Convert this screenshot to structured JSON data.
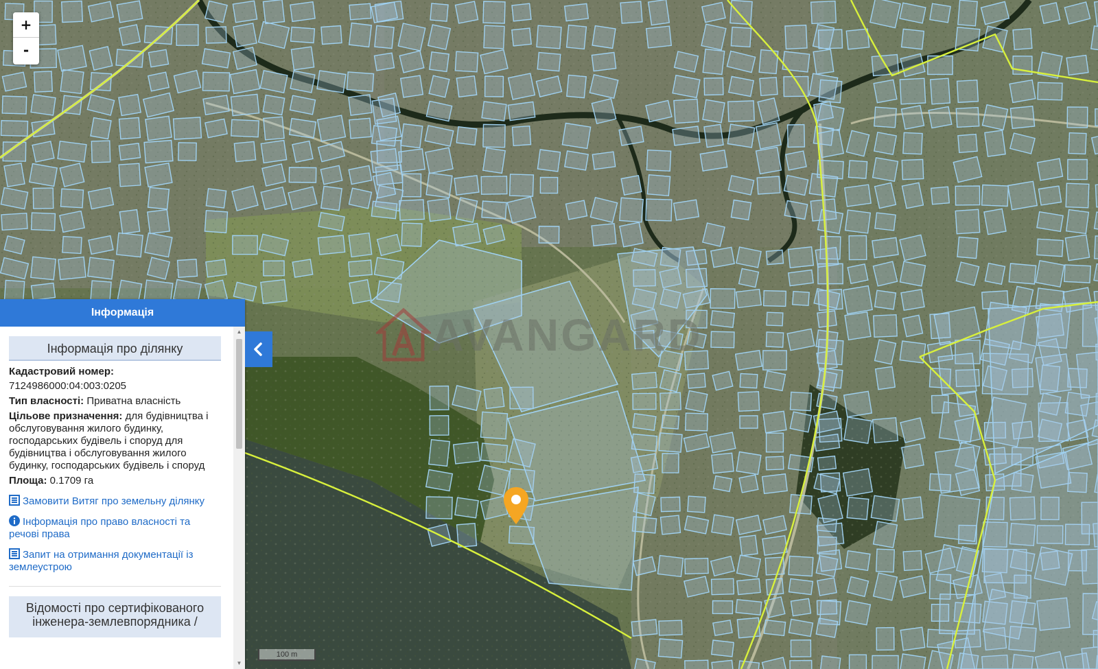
{
  "map": {
    "zoom_in_label": "+",
    "zoom_out_label": "-",
    "scale_label": "100 m",
    "watermark_text": "AVANGARD",
    "marker_color": "#f5a623",
    "parcel_border_color": "#9fd0f0",
    "boundary_color": "#d8f03c",
    "icons": {
      "zoom_in": "plus-icon",
      "zoom_out": "minus-icon",
      "marker": "map-pin-icon",
      "collapse": "chevron-left-icon"
    }
  },
  "panel": {
    "header": "Інформація",
    "section_title": "Інформація про ділянку",
    "cadastral_label": "Кадастровий номер:",
    "cadastral_value": "7124986000:04:003:0205",
    "ownership_label": "Тип власності:",
    "ownership_value": "Приватна власність",
    "purpose_label": "Цільове призначення:",
    "purpose_value": "для будівництва і обслуговування жилого будинку, господарських будівель і споруд для будівництва і обслуговування жилого будинку, господарських будівель і споруд",
    "area_label": "Площа:",
    "area_value": "0.1709 га",
    "links": [
      {
        "icon": "list-icon",
        "label": "Замовити Витяг про земельну ділянку"
      },
      {
        "icon": "info-icon",
        "label": "Інформація про право власності та речові права"
      },
      {
        "icon": "list-icon",
        "label": "Запит на отримання документації із землеустрою"
      }
    ],
    "certified_title": "Відомості про сертифікованого інженера-землевпорядника /"
  },
  "colors": {
    "panel_header": "#2f79d8",
    "link": "#1f6bc7",
    "section_bg": "#dde6f3"
  }
}
